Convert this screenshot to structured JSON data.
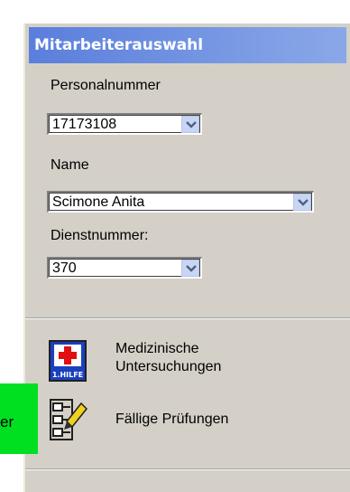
{
  "panel": {
    "title": "Mitarbeiterauswahl"
  },
  "fields": {
    "personalnummer": {
      "label": "Personalnummer",
      "value": "17173108"
    },
    "name": {
      "label": "Name",
      "value": "Scimone Anita"
    },
    "dienstnummer": {
      "label": "Dienstnummer:",
      "value": "370"
    }
  },
  "actions": {
    "medical": {
      "label_line1": "Medizinische",
      "label_line2": "Untersuchungen",
      "icon": "first-aid-icon",
      "icon_text": "1.HILFE"
    },
    "checks": {
      "label": "Fällige Prüfungen",
      "icon": "checklist-pencil-icon"
    }
  },
  "overlay": {
    "partial_text": "er",
    "color": "#00e020"
  },
  "colors": {
    "title_start": "#5a7edc",
    "title_end": "#8aa8e8",
    "panel_bg": "#d4d0c8",
    "first_aid_red": "#e01010",
    "first_aid_blue": "#1a40c0"
  }
}
